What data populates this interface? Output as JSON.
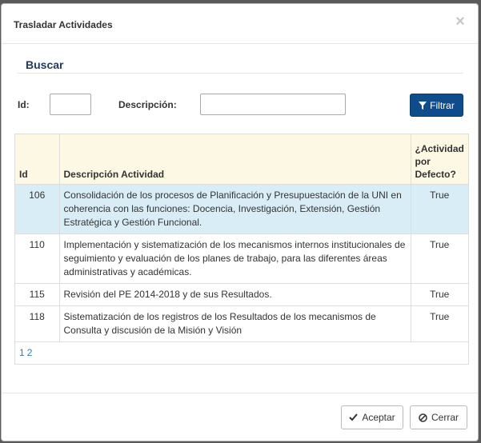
{
  "modal": {
    "title": "Trasladar Actividades",
    "close_icon": "close-icon"
  },
  "search": {
    "section_title": "Buscar",
    "id_label": "Id:",
    "id_value": "",
    "desc_label": "Descripción:",
    "desc_value": "",
    "filter_label": "Filtrar",
    "filter_icon": "filter-icon"
  },
  "table": {
    "columns": [
      "Id",
      "Descripción Actividad",
      "¿Actividad por Defecto?"
    ],
    "rows": [
      {
        "id": "106",
        "desc": "Consolidación de los procesos de Planificación y Presupuestación de la UNI en coherencia con las funciones: Docencia, Investigación, Extensión, Gestión Estratégica y Gestión Funcional.",
        "default": "True",
        "selected": true
      },
      {
        "id": "110",
        "desc": "Implementación y sistematización de los mecanismos internos institucionales de seguimiento y evaluación de los planes de trabajo, para las diferentes áreas administrativas y académicas.",
        "default": "True",
        "selected": false
      },
      {
        "id": "115",
        "desc": "Revisión del PE 2014-2018 y de sus Resultados.",
        "default": "True",
        "selected": false
      },
      {
        "id": "118",
        "desc": "Sistematización de los registros de los Resultados de los mecanismos de Consulta y discusión de la Misión y Visión",
        "default": "True",
        "selected": false
      }
    ],
    "pages": [
      "1",
      "2"
    ]
  },
  "footer": {
    "accept_label": "Aceptar",
    "accept_icon": "check-icon",
    "close_label": "Cerrar",
    "close_icon": "ban-icon"
  }
}
